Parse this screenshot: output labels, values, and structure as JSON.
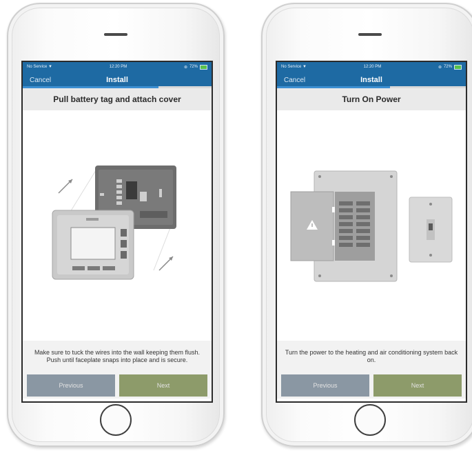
{
  "status_bar": {
    "carrier": "No Service",
    "time": "12:20 PM",
    "battery": "72%"
  },
  "screens": [
    {
      "cancel_label": "Cancel",
      "title": "Install",
      "step_title": "Pull battery tag and attach cover",
      "instructions": "Make sure to tuck the wires into the wall keeping them flush. Push until faceplate snaps into place and is secure.",
      "previous_label": "Previous",
      "next_label": "Next"
    },
    {
      "cancel_label": "Cancel",
      "title": "Install",
      "step_title": "Turn On Power",
      "instructions": "Turn the power to the heating and air conditioning system back on.",
      "previous_label": "Previous",
      "next_label": "Next"
    }
  ],
  "colors": {
    "header": "#1e6aa3",
    "previous_button": "#8a97a3",
    "next_button": "#8d9b6a"
  }
}
